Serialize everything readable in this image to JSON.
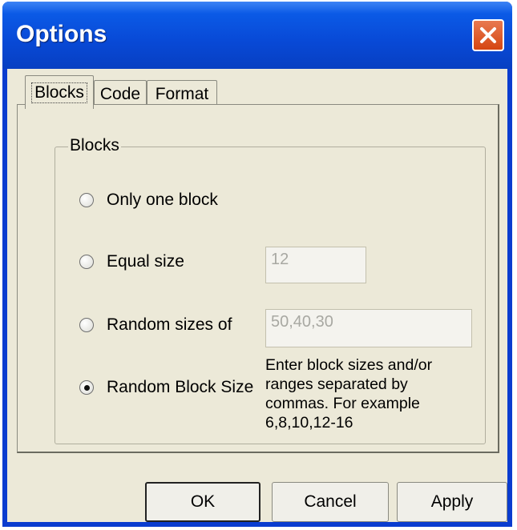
{
  "window": {
    "title": "Options"
  },
  "tabs": [
    {
      "label": "Blocks",
      "active": true
    },
    {
      "label": "Code",
      "active": false
    },
    {
      "label": "Format",
      "active": false
    }
  ],
  "group": {
    "legend": "Blocks",
    "options": [
      {
        "label": "Only one block",
        "checked": false
      },
      {
        "label": "Equal size",
        "checked": false
      },
      {
        "label": "Random sizes of",
        "checked": false
      },
      {
        "label": "Random Block Size",
        "checked": true
      }
    ],
    "equal_size_value": "12",
    "random_sizes_value": "50,40,30",
    "help_text": "Enter block sizes and/or ranges separated by commas. For example 6,8,10,12-16"
  },
  "buttons": {
    "ok": "OK",
    "cancel": "Cancel",
    "apply": "Apply"
  },
  "colors": {
    "titlebar": "#0849d6",
    "face": "#ece9d8",
    "close": "#d54612"
  }
}
